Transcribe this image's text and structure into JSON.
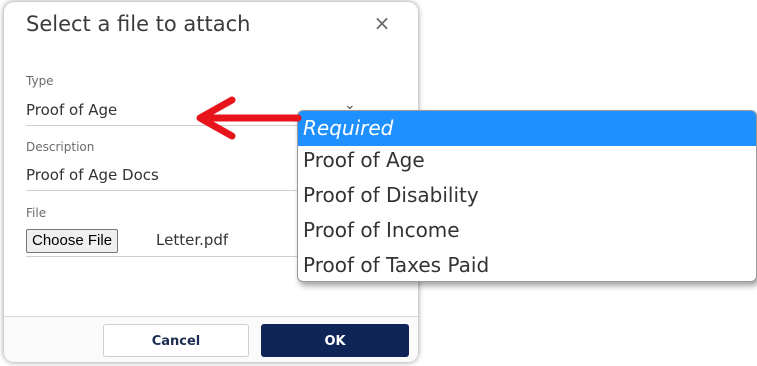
{
  "dialog": {
    "title": "Select a file to attach",
    "close_icon": "×",
    "type_label": "Type",
    "type_value": "Proof of Age",
    "description_label": "Description",
    "description_value": "Proof of Age Docs",
    "file_label": "File",
    "choose_file_label": "Choose File",
    "file_name": "Letter.pdf",
    "cancel_label": "Cancel",
    "ok_label": "OK"
  },
  "dropdown": {
    "options": [
      {
        "label": "Required",
        "selected": true
      },
      {
        "label": "Proof of Age",
        "selected": false
      },
      {
        "label": "Proof of Disability",
        "selected": false
      },
      {
        "label": "Proof of Income",
        "selected": false
      },
      {
        "label": "Proof of Taxes Paid",
        "selected": false
      }
    ]
  },
  "annotation": {
    "arrow_color": "#e8141b",
    "icon": "left-arrow"
  },
  "colors": {
    "primary": "#0f2557",
    "selected_option": "#1e90ff"
  }
}
